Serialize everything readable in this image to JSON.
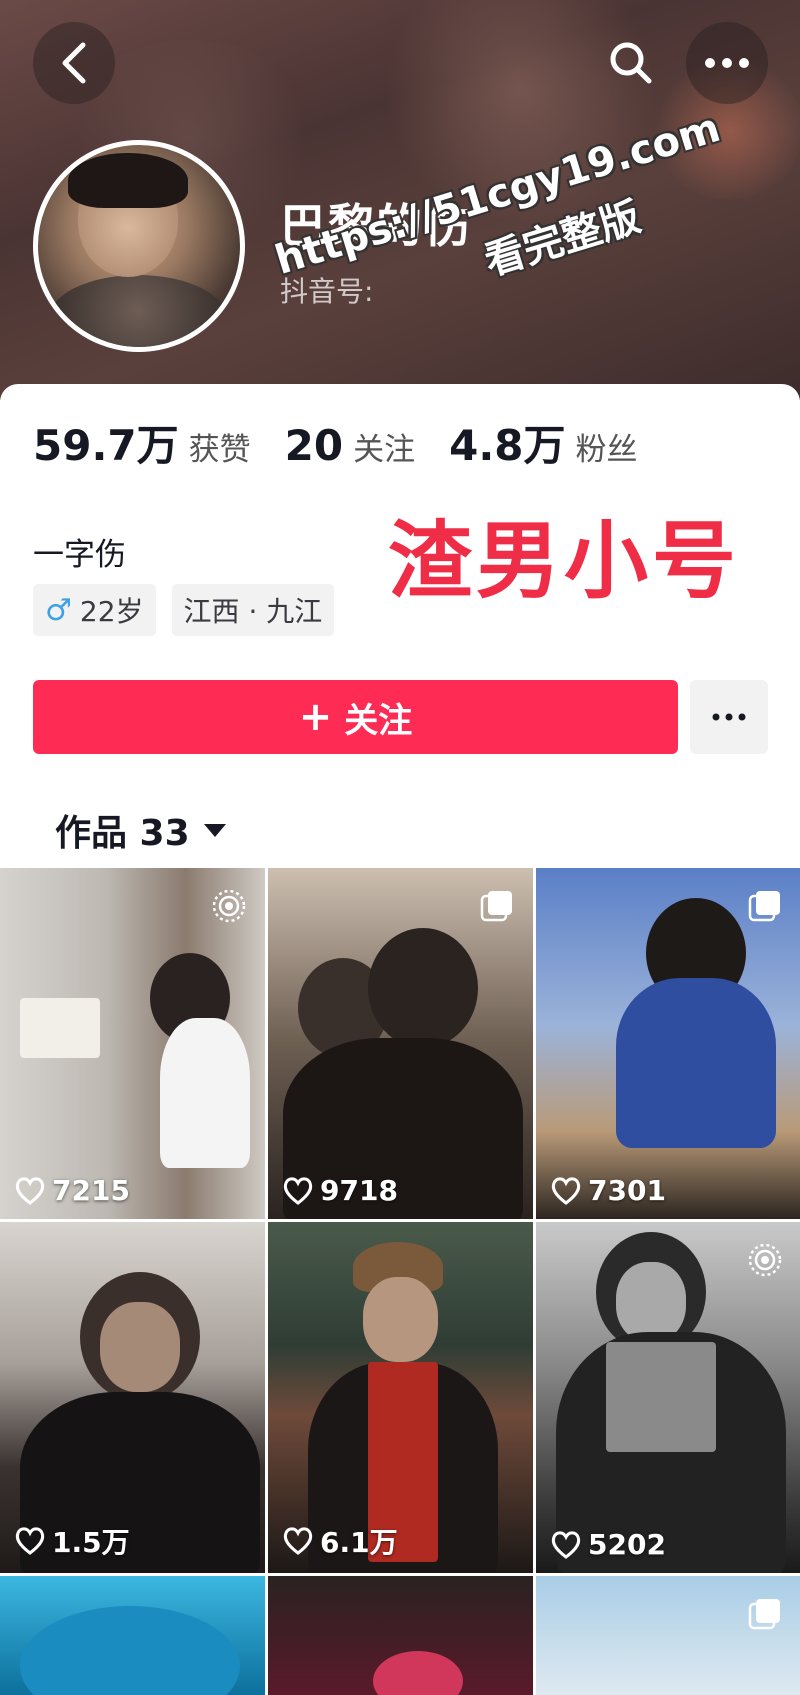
{
  "header": {
    "nickname": "巴黎的伤",
    "douyin_id_label": "抖音号:",
    "watermark_line1": "https://51cgy19.com",
    "watermark_line2": "看完整版"
  },
  "stats": [
    {
      "value": "59.7万",
      "label": "获赞"
    },
    {
      "value": "20",
      "label": "关注"
    },
    {
      "value": "4.8万",
      "label": "粉丝"
    }
  ],
  "profile": {
    "bio": "一字伤",
    "gender_icon": "♂",
    "age": "22岁",
    "location": "江西 · 九江",
    "overlay_caption": "渣男小号"
  },
  "actions": {
    "follow_plus": "+",
    "follow_label": "关注"
  },
  "works": {
    "tab_label": "作品 33",
    "items": [
      {
        "likes": "7215",
        "corner_icon": "live-photo-icon"
      },
      {
        "likes": "9718",
        "corner_icon": "multi-image-icon"
      },
      {
        "likes": "7301",
        "corner_icon": "multi-image-icon"
      },
      {
        "likes": "1.5万",
        "corner_icon": ""
      },
      {
        "likes": "6.1万",
        "corner_icon": ""
      },
      {
        "likes": "5202",
        "corner_icon": "live-photo-icon"
      },
      {
        "likes": "",
        "corner_icon": ""
      },
      {
        "likes": "",
        "corner_icon": ""
      },
      {
        "likes": "",
        "corner_icon": "multi-image-icon"
      }
    ]
  },
  "colors": {
    "accent": "#fe2c55",
    "caption_red": "#ef2d46",
    "male_blue": "#3da1e6"
  }
}
